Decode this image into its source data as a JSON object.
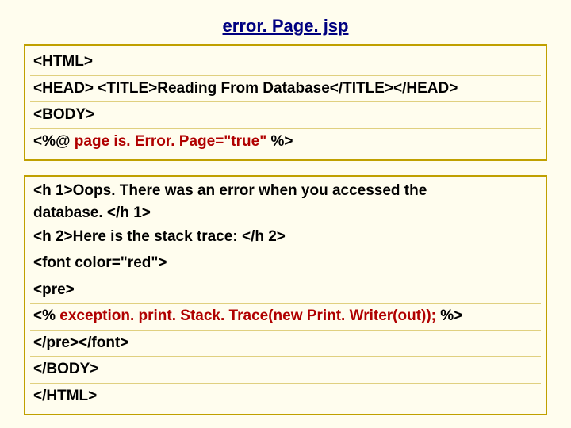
{
  "title": "error. Page. jsp",
  "box1": {
    "line1": "<HTML>",
    "line2": "<HEAD> <TITLE>Reading From Database</TITLE></HEAD>",
    "line3": "<BODY>",
    "line4_pre": "<%@ ",
    "line4_mid": "page is. Error. Page=\"true\"",
    "line4_post": " %>"
  },
  "box2": {
    "line1a": "<h 1>Oops. There was an error when you accessed the",
    "line1b": "database. </h 1>",
    "line2": "<h 2>Here is the stack trace: </h 2>",
    "line3": "<font color=\"red\">",
    "line4": "<pre>",
    "line5_pre": "<% ",
    "line5_mid": "exception. print. Stack. Trace(new Print. Writer(out));",
    "line5_post": " %>",
    "line6": "</pre></font>",
    "line7": "</BODY>",
    "line8": "</HTML>"
  }
}
